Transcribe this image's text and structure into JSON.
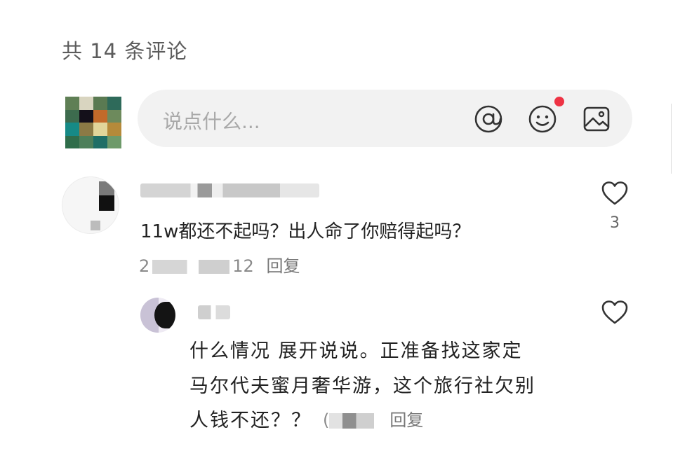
{
  "header": {
    "comment_count_text": "共 14 条评论"
  },
  "composer": {
    "placeholder": "说点什么...",
    "icons": [
      "at-icon",
      "emoji-icon",
      "image-icon"
    ],
    "emoji_notification_dot_color": "#ee3344"
  },
  "comments": [
    {
      "text": "11w都还不起吗？出人命了你赔得起吗？",
      "date_prefix": "2",
      "date_suffix": "12",
      "reply_label": "回复",
      "like_count": "3"
    }
  ],
  "replies": [
    {
      "text_lines": [
        "什么情况 展开说说。正准备找这家定",
        "马尔代夫蜜月奢华游，这个旅行社欠别",
        "人钱不还？？"
      ],
      "date_prefix": "(",
      "reply_label": "回复"
    }
  ]
}
